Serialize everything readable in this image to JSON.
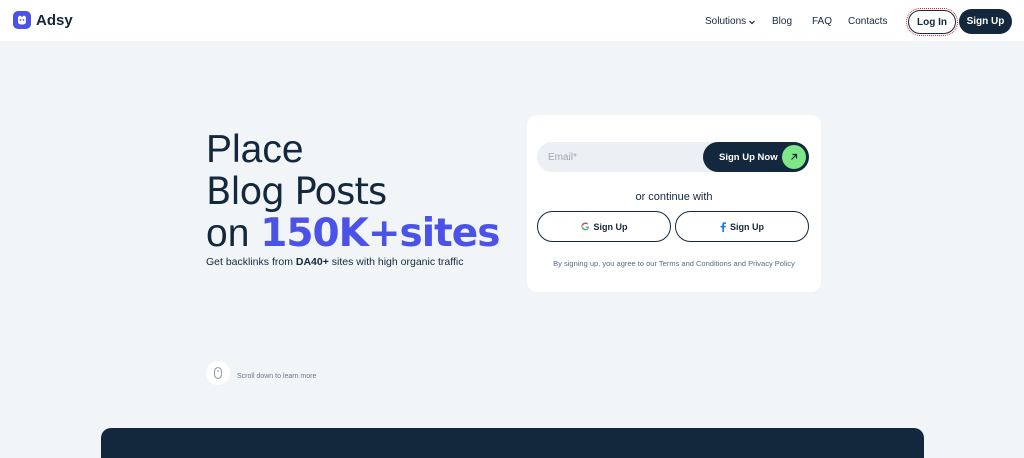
{
  "header": {
    "brand": "Adsy",
    "nav": {
      "solutions": "Solutions",
      "blog": "Blog",
      "faq": "FAQ",
      "contacts": "Contacts"
    },
    "login_label": "Log In",
    "signup_label": "Sign Up"
  },
  "hero": {
    "line1": "Place",
    "line2": "Blog Posts",
    "line3_prefix": "on ",
    "line3_accent": "150K+sites",
    "sub_prefix": "Get backlinks from ",
    "sub_bold": "DA40+",
    "sub_suffix": " sites with high organic traffic"
  },
  "signup_card": {
    "email_placeholder": "Email*",
    "email_value": "",
    "submit_label": "Sign Up Now",
    "continue_text": "or continue with",
    "google_label": "Sign Up",
    "facebook_label": "Sign Up",
    "terms_text": "By signing up, you agree to our Terms and Conditions and Privacy Policy"
  },
  "scroll_hint": "Scroll down to learn more",
  "colors": {
    "brand_navy": "#13273d",
    "accent_blue": "#4a52e8",
    "accent_green": "#7ee787",
    "background": "#f2f5f8"
  },
  "icons": [
    "logo-icon",
    "chevron-down-icon",
    "arrow-up-right-icon",
    "google-icon",
    "facebook-icon",
    "mouse-icon"
  ]
}
